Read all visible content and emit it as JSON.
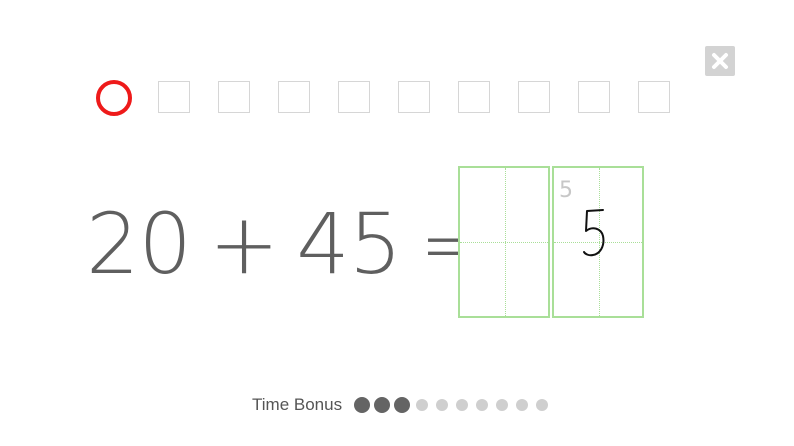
{
  "progress": {
    "total_slots": 10,
    "current_index": 0
  },
  "equation": {
    "operand_a": "20",
    "operator": "+",
    "operand_b": "45",
    "equals": "="
  },
  "answer": {
    "boxes": [
      {
        "hint": "",
        "handwritten": ""
      },
      {
        "hint": "5",
        "handwritten": "5"
      }
    ]
  },
  "time_bonus": {
    "label": "Time Bonus",
    "filled": 3,
    "total": 10
  },
  "colors": {
    "current_marker": "#ee1a1a",
    "answer_border": "#a9df98",
    "equation_text": "#5f5f5f"
  },
  "icons": {
    "close": "close-icon"
  }
}
